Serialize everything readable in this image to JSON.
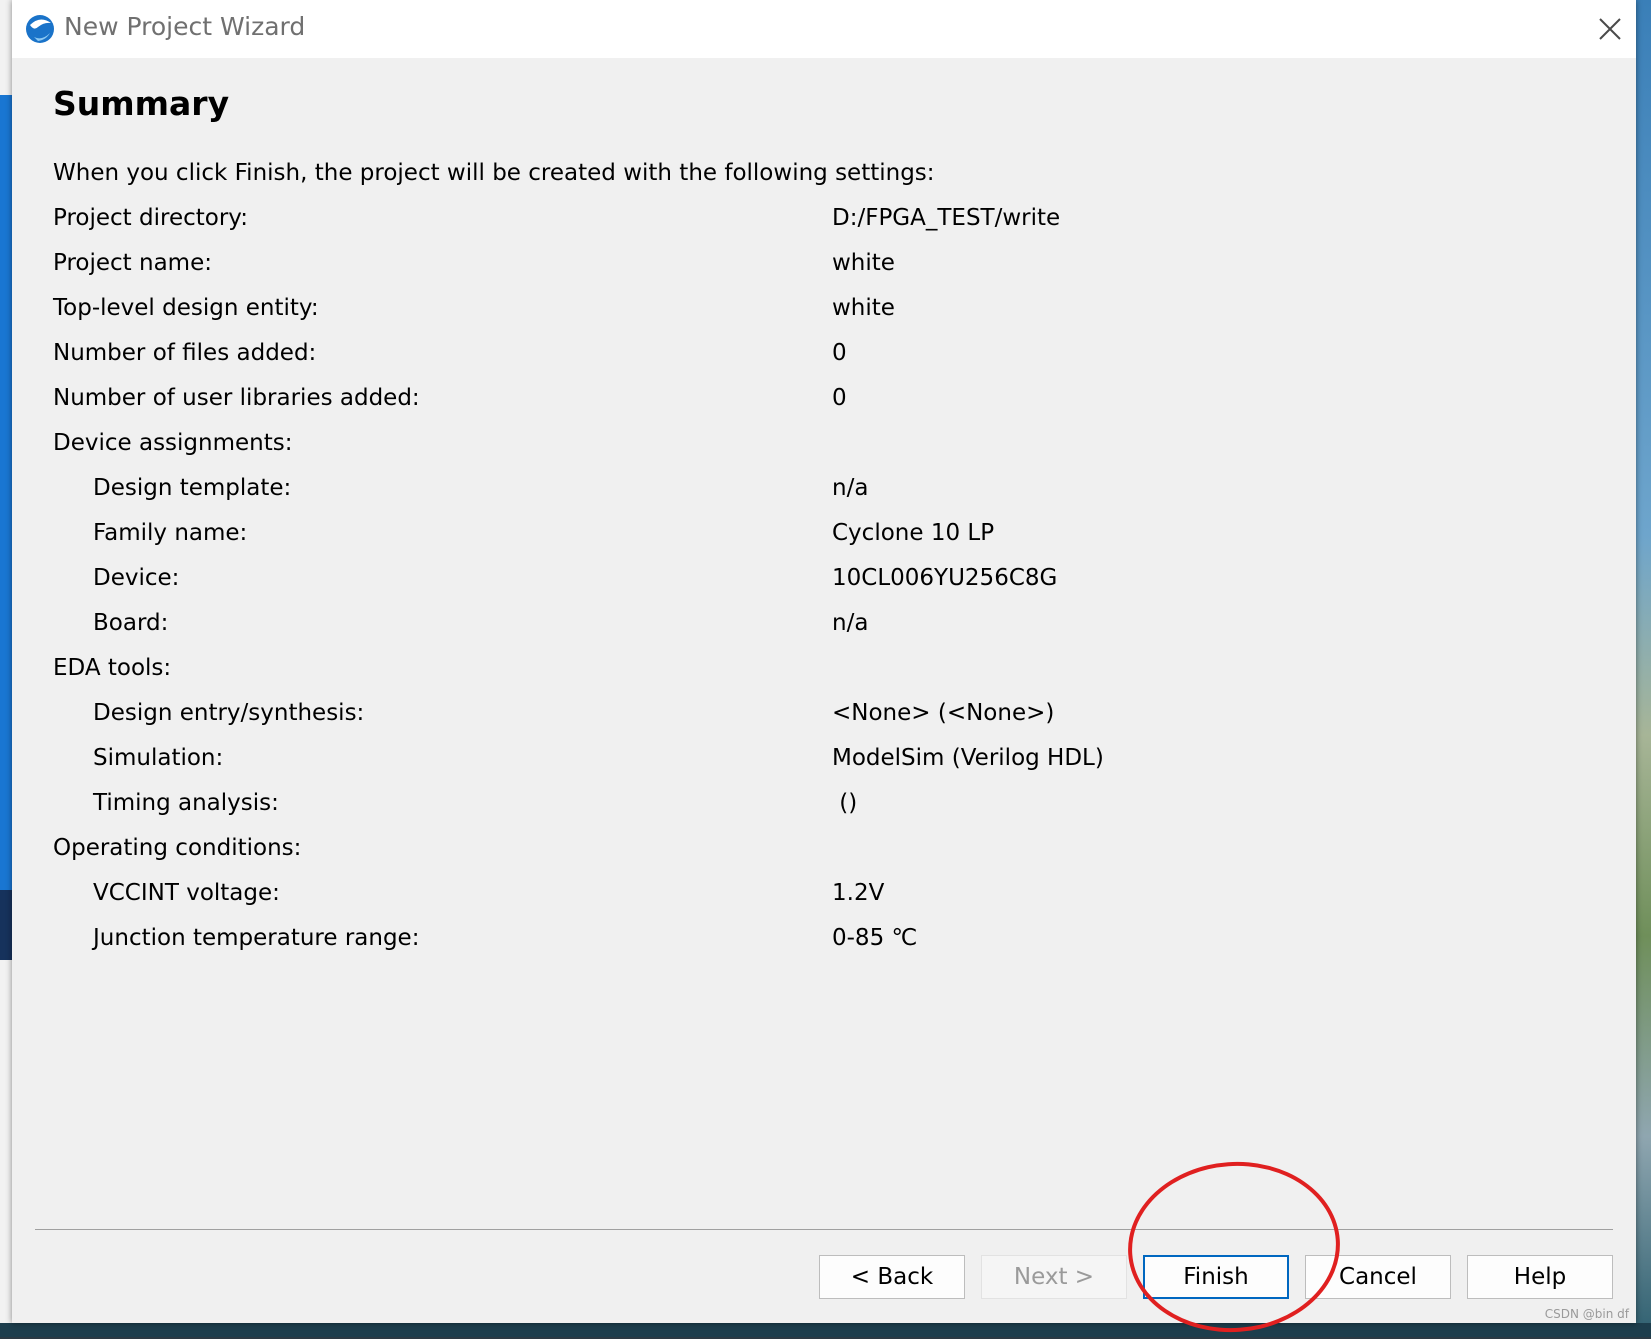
{
  "window": {
    "title": "New Project Wizard",
    "icon": "quartus-app-icon",
    "close_icon": "close-icon"
  },
  "page": {
    "heading": "Summary",
    "intro": "When you click Finish, the project will be created with the following settings:"
  },
  "settings": [
    {
      "label": "Project directory:",
      "value": "D:/FPGA_TEST/write",
      "indent": false
    },
    {
      "label": "Project name:",
      "value": "white",
      "indent": false
    },
    {
      "label": "Top-level design entity:",
      "value": "white",
      "indent": false
    },
    {
      "label": "Number of files added:",
      "value": "0",
      "indent": false
    },
    {
      "label": "Number of user libraries added:",
      "value": "0",
      "indent": false
    },
    {
      "label": "Device assignments:",
      "value": "",
      "indent": false
    },
    {
      "label": "Design template:",
      "value": "n/a",
      "indent": true
    },
    {
      "label": "Family name:",
      "value": "Cyclone 10 LP",
      "indent": true
    },
    {
      "label": "Device:",
      "value": "10CL006YU256C8G",
      "indent": true
    },
    {
      "label": "Board:",
      "value": "n/a",
      "indent": true
    },
    {
      "label": "EDA tools:",
      "value": "",
      "indent": false
    },
    {
      "label": "Design entry/synthesis:",
      "value": "<None> (<None>)",
      "indent": true
    },
    {
      "label": "Simulation:",
      "value": "ModelSim (Verilog HDL)",
      "indent": true
    },
    {
      "label": "Timing analysis:",
      "value": " ()",
      "indent": true
    },
    {
      "label": "Operating conditions:",
      "value": "",
      "indent": false
    },
    {
      "label": "VCCINT voltage:",
      "value": "1.2V",
      "indent": true
    },
    {
      "label": "Junction temperature range:",
      "value": "0-85 ℃",
      "indent": true
    }
  ],
  "buttons": {
    "back": "< Back",
    "next": "Next >",
    "finish": "Finish",
    "cancel": "Cancel",
    "help": "Help"
  },
  "watermark": "CSDN @bin df",
  "colors": {
    "accent": "#0067c0",
    "annotation": "#e02020"
  }
}
